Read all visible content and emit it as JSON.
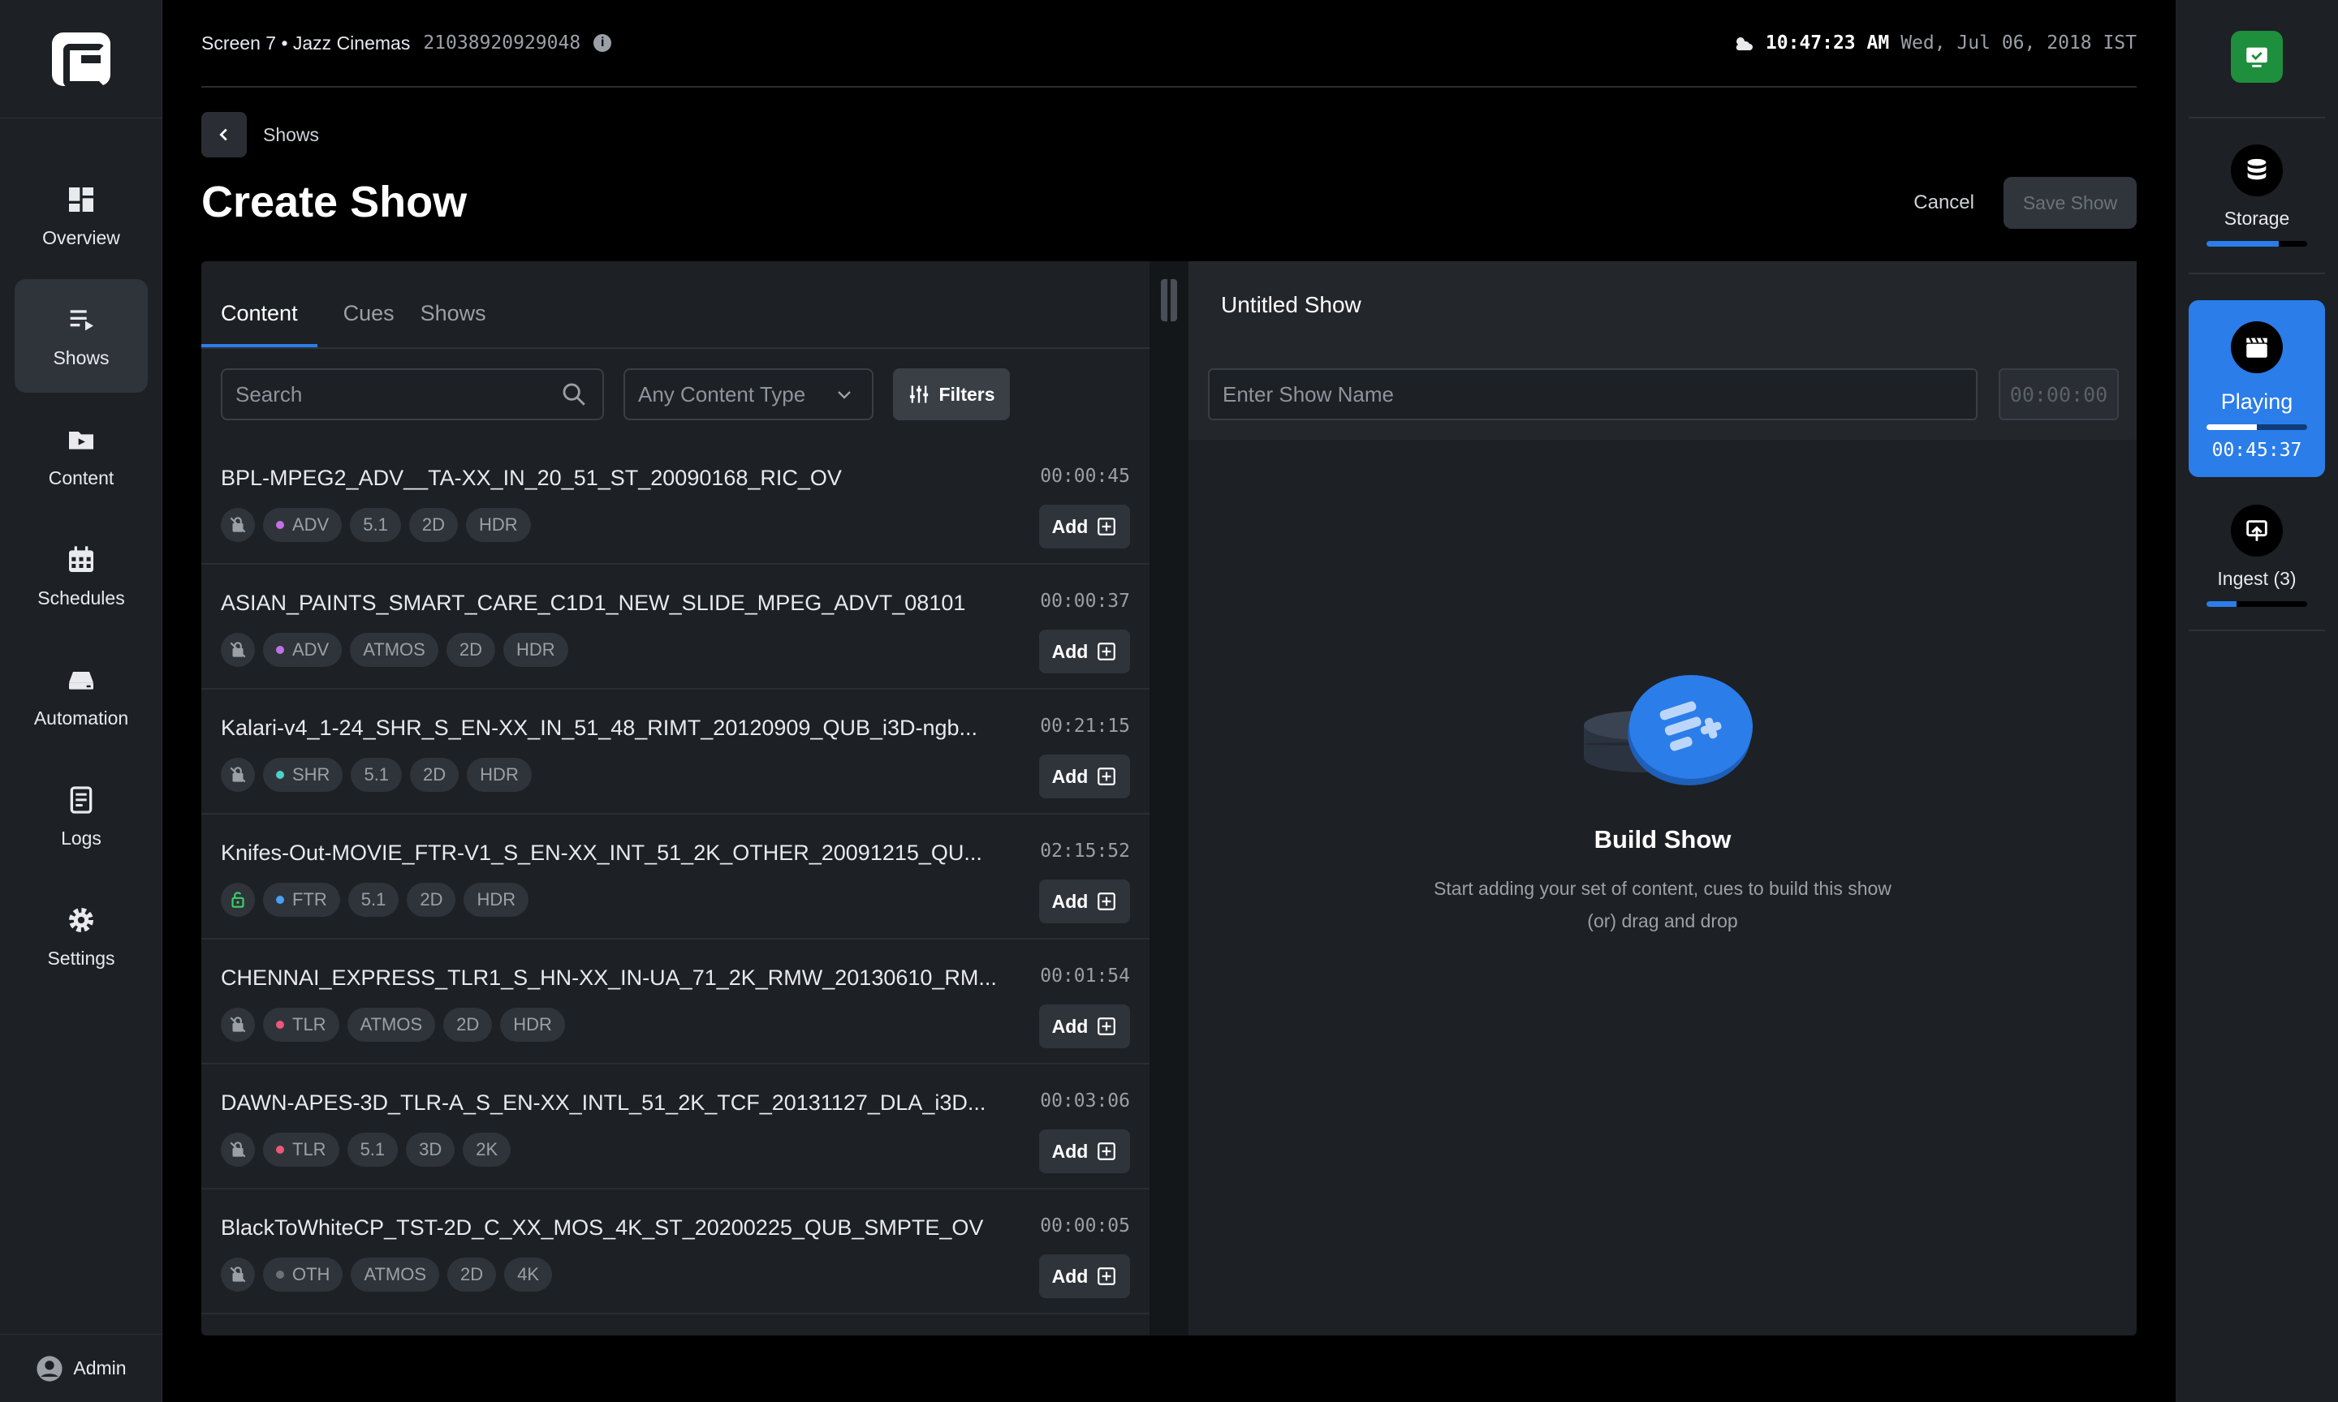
{
  "sidebar": {
    "items": [
      {
        "label": "Overview",
        "icon": "dashboard-icon",
        "active": false
      },
      {
        "label": "Shows",
        "icon": "playlist-icon",
        "active": true
      },
      {
        "label": "Content",
        "icon": "folder-play-icon",
        "active": false
      },
      {
        "label": "Schedules",
        "icon": "calendar-icon",
        "active": false
      },
      {
        "label": "Automation",
        "icon": "drive-icon",
        "active": false
      },
      {
        "label": "Logs",
        "icon": "document-icon",
        "active": false
      },
      {
        "label": "Settings",
        "icon": "gear-icon",
        "active": false
      }
    ],
    "user": "Admin"
  },
  "topbar": {
    "screen": "Screen 7 • Jazz Cinemas",
    "serial": "21038920929048",
    "time": "10:47:23 AM",
    "date": "Wed, Jul 06, 2018 IST"
  },
  "breadcrumb": {
    "label": "Shows"
  },
  "page": {
    "title": "Create Show",
    "cancel": "Cancel",
    "save": "Save Show"
  },
  "content_panel": {
    "tabs": [
      "Content",
      "Cues",
      "Shows"
    ],
    "search_placeholder": "Search",
    "type_select": "Any Content Type",
    "filters": "Filters",
    "add_label": "Add",
    "items": [
      {
        "name": "BPL-MPEG2_ADV__TA-XX_IN_20_51_ST_20090168_RIC_OV",
        "duration": "00:00:45",
        "locked": true,
        "kind": "ADV",
        "kind_color": "#c071e6",
        "tags": [
          "5.1",
          "2D",
          "HDR"
        ]
      },
      {
        "name": "ASIAN_PAINTS_SMART_CARE_C1D1_NEW_SLIDE_MPEG_ADVT_08101",
        "duration": "00:00:37",
        "locked": true,
        "kind": "ADV",
        "kind_color": "#c071e6",
        "tags": [
          "ATMOS",
          "2D",
          "HDR"
        ]
      },
      {
        "name": "Kalari-v4_1-24_SHR_S_EN-XX_IN_51_48_RIMT_20120909_QUB_i3D-ngb...",
        "duration": "00:21:15",
        "locked": true,
        "kind": "SHR",
        "kind_color": "#4fd1c5",
        "tags": [
          "5.1",
          "2D",
          "HDR"
        ]
      },
      {
        "name": "Knifes-Out-MOVIE_FTR-V1_S_EN-XX_INT_51_2K_OTHER_20091215_QU...",
        "duration": "02:15:52",
        "locked": false,
        "kind": "FTR",
        "kind_color": "#4a9ff5",
        "tags": [
          "5.1",
          "2D",
          "HDR"
        ]
      },
      {
        "name": "CHENNAI_EXPRESS_TLR1_S_HN-XX_IN-UA_71_2K_RMW_20130610_RM...",
        "duration": "00:01:54",
        "locked": true,
        "kind": "TLR",
        "kind_color": "#f0567a",
        "tags": [
          "ATMOS",
          "2D",
          "HDR"
        ]
      },
      {
        "name": "DAWN-APES-3D_TLR-A_S_EN-XX_INTL_51_2K_TCF_20131127_DLA_i3D...",
        "duration": "00:03:06",
        "locked": true,
        "kind": "TLR",
        "kind_color": "#f0567a",
        "tags": [
          "5.1",
          "3D",
          "2K"
        ]
      },
      {
        "name": "BlackToWhiteCP_TST-2D_C_XX_MOS_4K_ST_20200225_QUB_SMPTE_OV",
        "duration": "00:00:05",
        "locked": true,
        "kind": "OTH",
        "kind_color": "#6c727a",
        "tags": [
          "ATMOS",
          "2D",
          "4K"
        ]
      }
    ]
  },
  "show_panel": {
    "title": "Untitled Show",
    "name_placeholder": "Enter Show Name",
    "duration": "00:00:00",
    "empty_title": "Build Show",
    "empty_line1": "Start adding your set of content, cues to build this show",
    "empty_line2": "(or) drag and drop"
  },
  "rail": {
    "storage": {
      "label": "Storage",
      "progress": 0.72
    },
    "playing": {
      "label": "Playing",
      "time": "00:45:37",
      "progress": 0.5
    },
    "ingest": {
      "label": "Ingest (3)",
      "progress": 0.3
    }
  },
  "colors": {
    "accent": "#2b7de9",
    "success": "#1e8f3d",
    "panel": "#1d2024"
  }
}
